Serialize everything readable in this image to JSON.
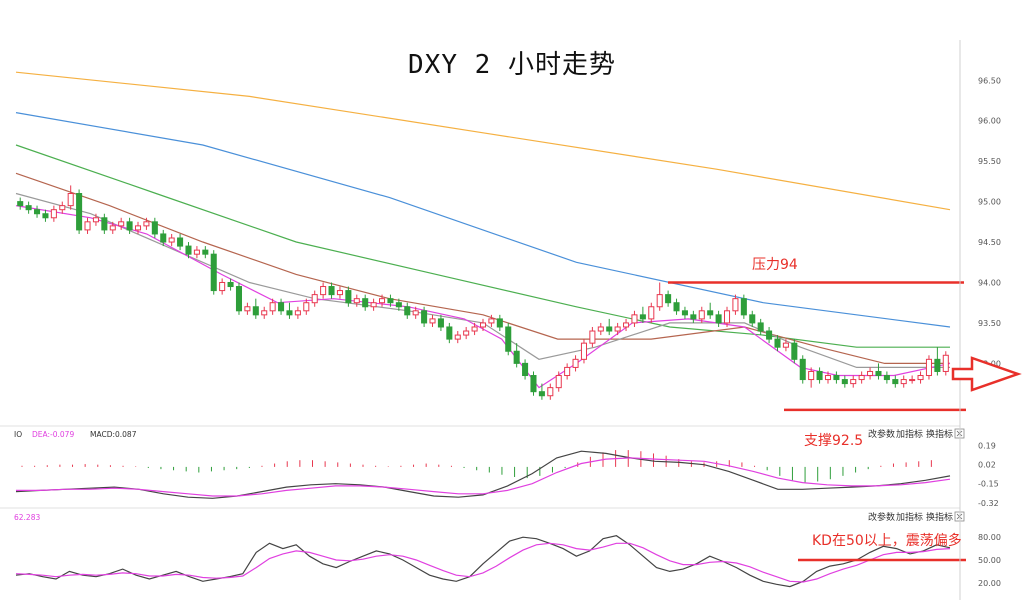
{
  "title": "DXY 2 小时走势",
  "annotations": {
    "resistance": "压力94",
    "support": "支撑92.5",
    "kd": "KD在50以上，震荡偏多"
  },
  "colors": {
    "annotation": "#e8302a",
    "up": "#e8384f",
    "down": "#2e9e3a",
    "ma_pink": "#e040e0",
    "ma_gray": "#9a9a9a",
    "ma_brown": "#b5654f",
    "ma_green": "#4caf50",
    "ma_blue": "#4a90d9",
    "ma_orange": "#f5b041",
    "k_line": "#444444",
    "d_line": "#e040e0"
  },
  "panel_buttons": [
    "改参数",
    "加指标",
    "换指标"
  ],
  "panel_close_icon": "close-icon",
  "arrow_icon": "right-arrow-outline-icon",
  "macd_panel": {
    "label_prefix": "IO",
    "dea": "DEA:-0.079",
    "macd": "MACD:0.087",
    "ticks": [
      "0.19",
      "0.02",
      "-0.15",
      "-0.32"
    ],
    "tick_values": [
      0.19,
      0.02,
      -0.15,
      -0.32
    ]
  },
  "kd_panel": {
    "label": "62.283",
    "ticks": [
      "80.00",
      "50.00",
      "20.00"
    ],
    "tick_values": [
      80,
      50,
      20
    ]
  },
  "chart_data": {
    "type": "candlestick",
    "title": "DXY 2 小时走势",
    "y_ticks": [
      "96.50",
      "96.00",
      "95.50",
      "95.00",
      "94.50",
      "94.00",
      "93.50",
      "93.00"
    ],
    "ylim": [
      92.3,
      96.8
    ],
    "resistance_level": 94.0,
    "support_level": 92.5,
    "kd_threshold": 50,
    "candles": [
      [
        95.0,
        95.05,
        94.9,
        94.95
      ],
      [
        94.95,
        95.0,
        94.85,
        94.9
      ],
      [
        94.9,
        94.95,
        94.8,
        94.85
      ],
      [
        94.85,
        94.9,
        94.75,
        94.8
      ],
      [
        94.8,
        94.95,
        94.75,
        94.9
      ],
      [
        94.9,
        95.0,
        94.85,
        94.95
      ],
      [
        94.95,
        95.2,
        94.9,
        95.1
      ],
      [
        95.1,
        95.15,
        94.6,
        94.65
      ],
      [
        94.65,
        94.8,
        94.6,
        94.75
      ],
      [
        94.75,
        94.85,
        94.7,
        94.8
      ],
      [
        94.8,
        94.85,
        94.6,
        94.65
      ],
      [
        94.65,
        94.75,
        94.6,
        94.7
      ],
      [
        94.7,
        94.8,
        94.65,
        94.75
      ],
      [
        94.75,
        94.8,
        94.6,
        94.65
      ],
      [
        94.65,
        94.75,
        94.6,
        94.7
      ],
      [
        94.7,
        94.8,
        94.65,
        94.75
      ],
      [
        94.75,
        94.8,
        94.55,
        94.6
      ],
      [
        94.6,
        94.65,
        94.45,
        94.5
      ],
      [
        94.5,
        94.6,
        94.45,
        94.55
      ],
      [
        94.55,
        94.6,
        94.4,
        94.45
      ],
      [
        94.45,
        94.5,
        94.3,
        94.35
      ],
      [
        94.35,
        94.45,
        94.3,
        94.4
      ],
      [
        94.4,
        94.45,
        94.3,
        94.35
      ],
      [
        94.35,
        94.4,
        93.85,
        93.9
      ],
      [
        93.9,
        94.05,
        93.85,
        94.0
      ],
      [
        94.0,
        94.05,
        93.9,
        93.95
      ],
      [
        93.95,
        94.0,
        93.6,
        93.65
      ],
      [
        93.65,
        93.75,
        93.6,
        93.7
      ],
      [
        93.7,
        93.8,
        93.55,
        93.6
      ],
      [
        93.6,
        93.7,
        93.55,
        93.65
      ],
      [
        93.65,
        93.8,
        93.6,
        93.75
      ],
      [
        93.75,
        93.8,
        93.6,
        93.65
      ],
      [
        93.65,
        93.75,
        93.55,
        93.6
      ],
      [
        93.6,
        93.7,
        93.55,
        93.65
      ],
      [
        93.65,
        93.8,
        93.6,
        93.75
      ],
      [
        93.75,
        93.9,
        93.7,
        93.85
      ],
      [
        93.85,
        94.0,
        93.8,
        93.95
      ],
      [
        93.95,
        94.0,
        93.8,
        93.85
      ],
      [
        93.85,
        93.95,
        93.8,
        93.9
      ],
      [
        93.9,
        93.95,
        93.7,
        93.75
      ],
      [
        93.75,
        93.85,
        93.7,
        93.8
      ],
      [
        93.8,
        93.85,
        93.65,
        93.7
      ],
      [
        93.7,
        93.8,
        93.65,
        93.75
      ],
      [
        93.75,
        93.85,
        93.7,
        93.8
      ],
      [
        93.8,
        93.85,
        93.7,
        93.75
      ],
      [
        93.75,
        93.8,
        93.65,
        93.7
      ],
      [
        93.7,
        93.75,
        93.55,
        93.6
      ],
      [
        93.6,
        93.7,
        93.55,
        93.65
      ],
      [
        93.65,
        93.7,
        93.45,
        93.5
      ],
      [
        93.5,
        93.6,
        93.45,
        93.55
      ],
      [
        93.55,
        93.6,
        93.4,
        93.45
      ],
      [
        93.45,
        93.5,
        93.25,
        93.3
      ],
      [
        93.3,
        93.4,
        93.25,
        93.35
      ],
      [
        93.35,
        93.45,
        93.3,
        93.4
      ],
      [
        93.4,
        93.5,
        93.35,
        93.45
      ],
      [
        93.45,
        93.55,
        93.4,
        93.5
      ],
      [
        93.5,
        93.6,
        93.45,
        93.55
      ],
      [
        93.55,
        93.6,
        93.4,
        93.45
      ],
      [
        93.45,
        93.5,
        93.1,
        93.15
      ],
      [
        93.15,
        93.25,
        92.95,
        93.0
      ],
      [
        93.0,
        93.05,
        92.8,
        92.85
      ],
      [
        92.85,
        92.9,
        92.6,
        92.65
      ],
      [
        92.65,
        92.75,
        92.55,
        92.6
      ],
      [
        92.6,
        92.75,
        92.55,
        92.7
      ],
      [
        92.7,
        92.9,
        92.65,
        92.85
      ],
      [
        92.85,
        93.0,
        92.8,
        92.95
      ],
      [
        92.95,
        93.1,
        92.9,
        93.05
      ],
      [
        93.05,
        93.3,
        93.0,
        93.25
      ],
      [
        93.25,
        93.45,
        93.2,
        93.4
      ],
      [
        93.4,
        93.5,
        93.35,
        93.45
      ],
      [
        93.45,
        93.55,
        93.35,
        93.4
      ],
      [
        93.4,
        93.5,
        93.35,
        93.45
      ],
      [
        93.45,
        93.55,
        93.4,
        93.5
      ],
      [
        93.5,
        93.65,
        93.45,
        93.6
      ],
      [
        93.6,
        93.7,
        93.5,
        93.55
      ],
      [
        93.55,
        93.75,
        93.5,
        93.7
      ],
      [
        93.7,
        94.0,
        93.65,
        93.85
      ],
      [
        93.85,
        93.9,
        93.7,
        93.75
      ],
      [
        93.75,
        93.8,
        93.6,
        93.65
      ],
      [
        93.65,
        93.7,
        93.55,
        93.6
      ],
      [
        93.6,
        93.65,
        93.5,
        93.55
      ],
      [
        93.55,
        93.7,
        93.5,
        93.65
      ],
      [
        93.65,
        93.75,
        93.55,
        93.6
      ],
      [
        93.6,
        93.65,
        93.45,
        93.5
      ],
      [
        93.5,
        93.7,
        93.45,
        93.65
      ],
      [
        93.65,
        93.85,
        93.6,
        93.8
      ],
      [
        93.8,
        93.85,
        93.55,
        93.6
      ],
      [
        93.6,
        93.65,
        93.45,
        93.5
      ],
      [
        93.5,
        93.55,
        93.35,
        93.4
      ],
      [
        93.4,
        93.45,
        93.25,
        93.3
      ],
      [
        93.3,
        93.35,
        93.15,
        93.2
      ],
      [
        93.2,
        93.3,
        93.15,
        93.25
      ],
      [
        93.25,
        93.3,
        93.0,
        93.05
      ],
      [
        93.05,
        93.1,
        92.75,
        92.8
      ],
      [
        92.8,
        92.95,
        92.7,
        92.9
      ],
      [
        92.9,
        92.95,
        92.75,
        92.8
      ],
      [
        92.8,
        92.9,
        92.75,
        92.85
      ],
      [
        92.85,
        92.9,
        92.75,
        92.8
      ],
      [
        92.8,
        92.85,
        92.7,
        92.75
      ],
      [
        92.75,
        92.85,
        92.7,
        92.8
      ],
      [
        92.8,
        92.9,
        92.75,
        92.85
      ],
      [
        92.85,
        92.95,
        92.8,
        92.9
      ],
      [
        92.9,
        93.0,
        92.8,
        92.85
      ],
      [
        92.85,
        92.9,
        92.75,
        92.8
      ],
      [
        92.8,
        92.85,
        92.7,
        92.75
      ],
      [
        92.75,
        92.85,
        92.7,
        92.8
      ],
      [
        92.8,
        92.85,
        92.75,
        92.8
      ],
      [
        92.8,
        92.9,
        92.75,
        92.85
      ],
      [
        92.85,
        93.1,
        92.8,
        93.05
      ],
      [
        93.05,
        93.2,
        92.85,
        92.9
      ],
      [
        92.9,
        93.15,
        92.85,
        93.1
      ]
    ],
    "ma_series": [
      {
        "color_key": "ma_orange",
        "points": [
          [
            0,
            96.6
          ],
          [
            0.25,
            96.3
          ],
          [
            0.5,
            95.85
          ],
          [
            0.75,
            95.4
          ],
          [
            1,
            94.9
          ]
        ]
      },
      {
        "color_key": "ma_blue",
        "points": [
          [
            0,
            96.1
          ],
          [
            0.2,
            95.7
          ],
          [
            0.4,
            95.05
          ],
          [
            0.6,
            94.25
          ],
          [
            0.8,
            93.75
          ],
          [
            1,
            93.45
          ]
        ]
      },
      {
        "color_key": "ma_green",
        "points": [
          [
            0,
            95.7
          ],
          [
            0.15,
            95.1
          ],
          [
            0.3,
            94.5
          ],
          [
            0.45,
            94.1
          ],
          [
            0.6,
            93.7
          ],
          [
            0.7,
            93.45
          ],
          [
            0.8,
            93.35
          ],
          [
            0.9,
            93.2
          ],
          [
            1,
            93.2
          ]
        ]
      },
      {
        "color_key": "ma_brown",
        "points": [
          [
            0,
            95.35
          ],
          [
            0.1,
            94.95
          ],
          [
            0.2,
            94.5
          ],
          [
            0.3,
            94.1
          ],
          [
            0.4,
            93.8
          ],
          [
            0.5,
            93.6
          ],
          [
            0.58,
            93.3
          ],
          [
            0.68,
            93.3
          ],
          [
            0.78,
            93.45
          ],
          [
            0.86,
            93.2
          ],
          [
            0.93,
            93.0
          ],
          [
            1,
            93.0
          ]
        ]
      },
      {
        "color_key": "ma_gray",
        "points": [
          [
            0,
            95.1
          ],
          [
            0.08,
            94.85
          ],
          [
            0.16,
            94.45
          ],
          [
            0.25,
            94.0
          ],
          [
            0.32,
            93.8
          ],
          [
            0.42,
            93.65
          ],
          [
            0.5,
            93.5
          ],
          [
            0.56,
            93.05
          ],
          [
            0.62,
            93.2
          ],
          [
            0.7,
            93.5
          ],
          [
            0.78,
            93.5
          ],
          [
            0.84,
            93.2
          ],
          [
            0.9,
            92.95
          ],
          [
            1,
            92.95
          ]
        ]
      },
      {
        "color_key": "ma_pink",
        "points": [
          [
            0,
            94.95
          ],
          [
            0.08,
            94.8
          ],
          [
            0.14,
            94.6
          ],
          [
            0.22,
            94.1
          ],
          [
            0.28,
            93.75
          ],
          [
            0.34,
            93.8
          ],
          [
            0.42,
            93.7
          ],
          [
            0.48,
            93.55
          ],
          [
            0.52,
            93.3
          ],
          [
            0.56,
            92.7
          ],
          [
            0.6,
            93.0
          ],
          [
            0.66,
            93.5
          ],
          [
            0.72,
            93.55
          ],
          [
            0.78,
            93.45
          ],
          [
            0.84,
            92.95
          ],
          [
            0.88,
            92.85
          ],
          [
            0.94,
            92.85
          ],
          [
            1,
            93.0
          ]
        ]
      }
    ],
    "macd_hist": [
      0.01,
      0.01,
      0.015,
      0.02,
      0.02,
      0.025,
      0.02,
      0.015,
      0.01,
      0.005,
      -0.01,
      -0.02,
      -0.03,
      -0.04,
      -0.05,
      -0.04,
      -0.03,
      -0.02,
      -0.01,
      0.01,
      0.03,
      0.05,
      0.06,
      0.06,
      0.05,
      0.04,
      0.03,
      0.02,
      0.01,
      0.005,
      0.01,
      0.02,
      0.03,
      0.02,
      0.01,
      -0.01,
      -0.03,
      -0.05,
      -0.07,
      -0.09,
      -0.1,
      -0.08,
      -0.05,
      -0.01,
      0.04,
      0.09,
      0.13,
      0.15,
      0.15,
      0.14,
      0.12,
      0.1,
      0.07,
      0.05,
      0.04,
      0.05,
      0.06,
      0.04,
      0.01,
      -0.03,
      -0.08,
      -0.12,
      -0.14,
      -0.13,
      -0.11,
      -0.08,
      -0.05,
      -0.02,
      0.01,
      0.03,
      0.04,
      0.05,
      0.06
    ],
    "dif_line": [
      -0.22,
      -0.21,
      -0.2,
      -0.19,
      -0.18,
      -0.2,
      -0.24,
      -0.27,
      -0.28,
      -0.26,
      -0.22,
      -0.18,
      -0.16,
      -0.15,
      -0.16,
      -0.18,
      -0.22,
      -0.26,
      -0.27,
      -0.25,
      -0.17,
      -0.06,
      0.08,
      0.14,
      0.12,
      0.08,
      0.05,
      0.04,
      0.02,
      -0.04,
      -0.12,
      -0.2,
      -0.2,
      -0.19,
      -0.18,
      -0.17,
      -0.15,
      -0.12,
      -0.08
    ],
    "dea_line": [
      -0.21,
      -0.21,
      -0.2,
      -0.2,
      -0.19,
      -0.2,
      -0.22,
      -0.24,
      -0.26,
      -0.26,
      -0.24,
      -0.21,
      -0.19,
      -0.17,
      -0.17,
      -0.18,
      -0.2,
      -0.22,
      -0.24,
      -0.24,
      -0.21,
      -0.15,
      -0.05,
      0.03,
      0.07,
      0.08,
      0.07,
      0.06,
      0.05,
      0.01,
      -0.04,
      -0.1,
      -0.14,
      -0.16,
      -0.17,
      -0.17,
      -0.16,
      -0.14,
      -0.11
    ],
    "k_line": [
      30,
      32,
      28,
      25,
      35,
      30,
      28,
      32,
      38,
      30,
      25,
      30,
      35,
      28,
      22,
      25,
      28,
      32,
      60,
      72,
      65,
      70,
      55,
      45,
      40,
      48,
      55,
      62,
      58,
      50,
      40,
      30,
      25,
      22,
      28,
      45,
      60,
      75,
      80,
      78,
      72,
      65,
      55,
      62,
      78,
      82,
      70,
      55,
      40,
      35,
      38,
      45,
      55,
      48,
      40,
      30,
      22,
      18,
      15,
      22,
      35,
      42,
      45,
      50,
      60,
      68,
      65,
      58,
      62,
      70,
      66
    ],
    "d_line": [
      32,
      31,
      30,
      28,
      30,
      31,
      30,
      31,
      33,
      32,
      29,
      29,
      31,
      30,
      27,
      26,
      27,
      29,
      40,
      52,
      58,
      62,
      60,
      55,
      50,
      49,
      51,
      55,
      57,
      55,
      50,
      43,
      36,
      30,
      28,
      33,
      42,
      53,
      63,
      70,
      72,
      70,
      65,
      63,
      67,
      72,
      72,
      66,
      57,
      49,
      44,
      44,
      47,
      48,
      46,
      41,
      34,
      28,
      22,
      21,
      25,
      32,
      38,
      43,
      50,
      57,
      60,
      60,
      61,
      64,
      65
    ]
  }
}
